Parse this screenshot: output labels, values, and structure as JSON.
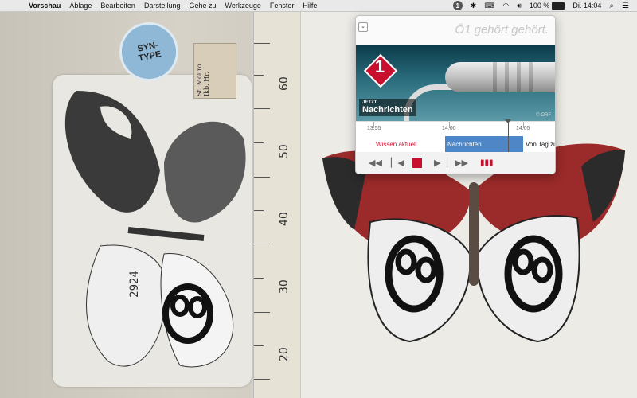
{
  "menubar": {
    "app_name": "Vorschau",
    "menus": [
      "Ablage",
      "Bearbeiten",
      "Darstellung",
      "Gehe zu",
      "Werkzeuge",
      "Fenster",
      "Hilfe"
    ],
    "status": {
      "battery": "100 %",
      "clock": "Di. 14:04"
    }
  },
  "radio_popover": {
    "slogan": "Ö1 gehört gehört.",
    "logo_number": "1",
    "live": {
      "now_label": "JETZT",
      "title": "Nachrichten"
    },
    "copyright": "© ORF",
    "timeline": {
      "times": [
        "13:55",
        "14:00",
        "14:05"
      ],
      "programs": [
        {
          "title": "Wissen aktuell"
        },
        {
          "title": "Nachrichten"
        },
        {
          "title": "Von Tag zu"
        }
      ]
    },
    "controls": [
      "rewind",
      "previous",
      "stop",
      "next",
      "fast-forward",
      "volume"
    ]
  },
  "background": {
    "label_syn_type": "SYN-\nTYPE",
    "label_locality": "St. Mouro\nIkb. Hr.",
    "specimen_number": "2924",
    "ruler_numbers": [
      "60",
      "50",
      "40",
      "30",
      "20"
    ]
  },
  "colors": {
    "accent": "#c8102e",
    "timeline_active": "#4e86c6"
  }
}
